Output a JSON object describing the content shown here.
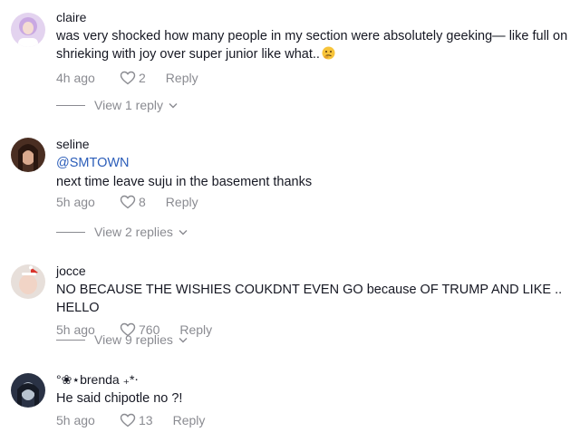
{
  "comments": [
    {
      "username": "claire",
      "mention": "",
      "text": "was very shocked how many people in my section were absolutely geeking— like full on shrieking with joy over super junior like what..",
      "emoji": "thinking-face-emoji",
      "time": "4h ago",
      "likes": "2",
      "reply_label": "Reply",
      "view_replies": "View 1 reply"
    },
    {
      "username": "seline",
      "mention": "@SMTOWN",
      "text": "next time leave suju in the basement thanks",
      "time": "5h ago",
      "likes": "8",
      "reply_label": "Reply",
      "view_replies": "View 2 replies"
    },
    {
      "username": "jocce",
      "mention": "",
      "text": "NO BECAUSE THE WISHIES COUKDNT EVEN GO because OF TRUMP AND LIKE .. HELLO",
      "time": "5h ago",
      "likes": "760",
      "reply_label": "Reply",
      "view_replies": "View 9 replies"
    },
    {
      "username": "°❀⋆brenda ₊*⋅",
      "mention": "",
      "text": "He said chipotle no ?!",
      "time": "5h ago",
      "likes": "13",
      "reply_label": "Reply"
    }
  ],
  "icons": {
    "like": "heart-outline-icon",
    "expand": "chevron-down-icon"
  },
  "colors": {
    "text": "#161823",
    "secondary": "#8a8b91",
    "mention": "#2b5db9"
  }
}
